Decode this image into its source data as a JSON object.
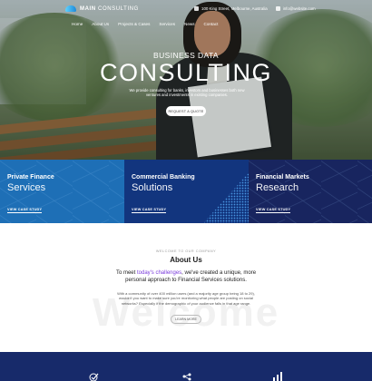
{
  "header": {
    "logo_text_bold": "MAIN",
    "logo_text_light": "CONSULTING",
    "address": "100 King Street, Melbourne, Australia",
    "email": "info@website.com"
  },
  "nav": {
    "items": [
      "Home",
      "About Us",
      "Projects & Cases",
      "Services",
      "News",
      "Contact"
    ]
  },
  "hero": {
    "subtitle": "BUSINESS DATA",
    "title": "CONSULTING",
    "description": "We provide consulting for banks, investors and businesses both new ventures and investments in existing companies.",
    "cta_label": "REQUEST A QUOTE"
  },
  "services": [
    {
      "title": "Private Finance",
      "subtitle": "Services",
      "link": "VIEW CASE STUDY",
      "color": "#1e6fb6"
    },
    {
      "title": "Commercial Banking",
      "subtitle": "Solutions",
      "link": "VIEW CASE STUDY",
      "color": "#12357e"
    },
    {
      "title": "Financial Markets",
      "subtitle": "Research",
      "link": "VIEW CASE STUDY",
      "color": "#18255f"
    }
  ],
  "about": {
    "kicker": "WELCOME TO OUR COMPANY",
    "title": "About Us",
    "lead_before": "To meet ",
    "lead_highlight": "today's challenges",
    "lead_after": ", we've created a unique, more personal approach to Financial Services solutions.",
    "body": "With a community of over 400 million users (and a majority age group being 18 to 29), wouldn't you want to make sure you're monitoring what people are posting on social networks? Especially if the demographic of your audience falls in that age range.",
    "button_label": "LEARN MORE",
    "watermark": "Welcome",
    "highlight_color": "#7a3bdc"
  },
  "bottom_icons": [
    "check-icon",
    "network-icon",
    "chart-icon"
  ]
}
